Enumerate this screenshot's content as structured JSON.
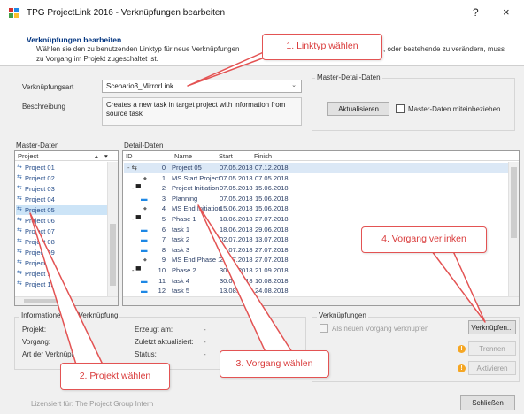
{
  "window": {
    "title": "TPG ProjectLink 2016 - Verknüpfungen bearbeiten",
    "help": "?",
    "close": "×"
  },
  "header": {
    "title": "Verknüpfungen bearbeiten",
    "text_left": "Wählen sie den zu benutzenden Linktyp für neue Verknüpfungen",
    "text_right": ", oder bestehende zu verändern, muss",
    "text2": "zu Vorgang im Projekt zugeschaltet ist."
  },
  "link_type": {
    "label": "Verknüpfungsart",
    "value": "Scenario3_MirrorLink",
    "description_label": "Beschreibung",
    "description": "Creates a new task in target project with information from source task"
  },
  "master_detail": {
    "group_label": "Master-Detail-Daten",
    "refresh_button": "Aktualisieren",
    "checkbox_label": "Master-Daten miteinbeziehen"
  },
  "master": {
    "label": "Master-Daten",
    "column": "Project",
    "items": [
      "Project 01",
      "Project 02",
      "Project 03",
      "Project 04",
      "Project 05",
      "Project 06",
      "Project 07",
      "Project 08",
      "Project 09",
      "Project 10",
      "Project 11",
      "Project 12"
    ],
    "selected_index": 4
  },
  "detail": {
    "label": "Detail-Daten",
    "columns": {
      "id": "ID",
      "name": "Name",
      "start": "Start",
      "finish": "Finish"
    },
    "rows": [
      {
        "id": "0",
        "name": "Project 05",
        "start": "07.05.2018",
        "finish": "07.12.2018"
      },
      {
        "id": "1",
        "name": "MS Start Project",
        "start": "07.05.2018",
        "finish": "07.05.2018"
      },
      {
        "id": "2",
        "name": "Project Initiation",
        "start": "07.05.2018",
        "finish": "15.06.2018"
      },
      {
        "id": "3",
        "name": "Planning",
        "start": "07.05.2018",
        "finish": "15.06.2018"
      },
      {
        "id": "4",
        "name": "MS End Initiation",
        "start": "15.06.2018",
        "finish": "15.06.2018"
      },
      {
        "id": "5",
        "name": "Phase 1",
        "start": "18.06.2018",
        "finish": "27.07.2018"
      },
      {
        "id": "6",
        "name": "task 1",
        "start": "18.06.2018",
        "finish": "29.06.2018"
      },
      {
        "id": "7",
        "name": "task 2",
        "start": "02.07.2018",
        "finish": "13.07.2018"
      },
      {
        "id": "8",
        "name": "task 3",
        "start": "16.07.2018",
        "finish": "27.07.2018"
      },
      {
        "id": "9",
        "name": "MS End Phase 1",
        "start": "27.07.2018",
        "finish": "27.07.2018"
      },
      {
        "id": "10",
        "name": "Phase 2",
        "start": "30.07.2018",
        "finish": "21.09.2018"
      },
      {
        "id": "11",
        "name": "task 4",
        "start": "30.07.2018",
        "finish": "10.08.2018"
      },
      {
        "id": "12",
        "name": "task 5",
        "start": "13.08.2018",
        "finish": "24.08.2018"
      }
    ]
  },
  "info": {
    "label": "Informationen zur Verknüpfung",
    "project_label": "Projekt:",
    "task_label": "Vorgang:",
    "type_label": "Art der Verknüpfung:",
    "created_label": "Erzeugt am:",
    "updated_label": "Zuletzt aktualisiert:",
    "status_label": "Status:",
    "created_value": "-",
    "updated_value": "-",
    "status_value": "-"
  },
  "links": {
    "label": "Verknüpfungen",
    "checkbox_label": "Als neuen Vorgang verknüpfen",
    "link_button": "Verknüpfen...",
    "separate_button": "Trennen",
    "update_button": "Aktivieren"
  },
  "footer": {
    "license": "Lizensiert für: The Project Group Intern",
    "close_button": "Schließen"
  },
  "callouts": {
    "c1": "1. Linktyp wählen",
    "c2": "2. Projekt wählen",
    "c3": "3. Vorgang wählen",
    "c4": "4. Vorgang verlinken"
  },
  "colors": {
    "accent": "#00337f",
    "callout": "#e35353",
    "selection": "#cce4f7"
  }
}
